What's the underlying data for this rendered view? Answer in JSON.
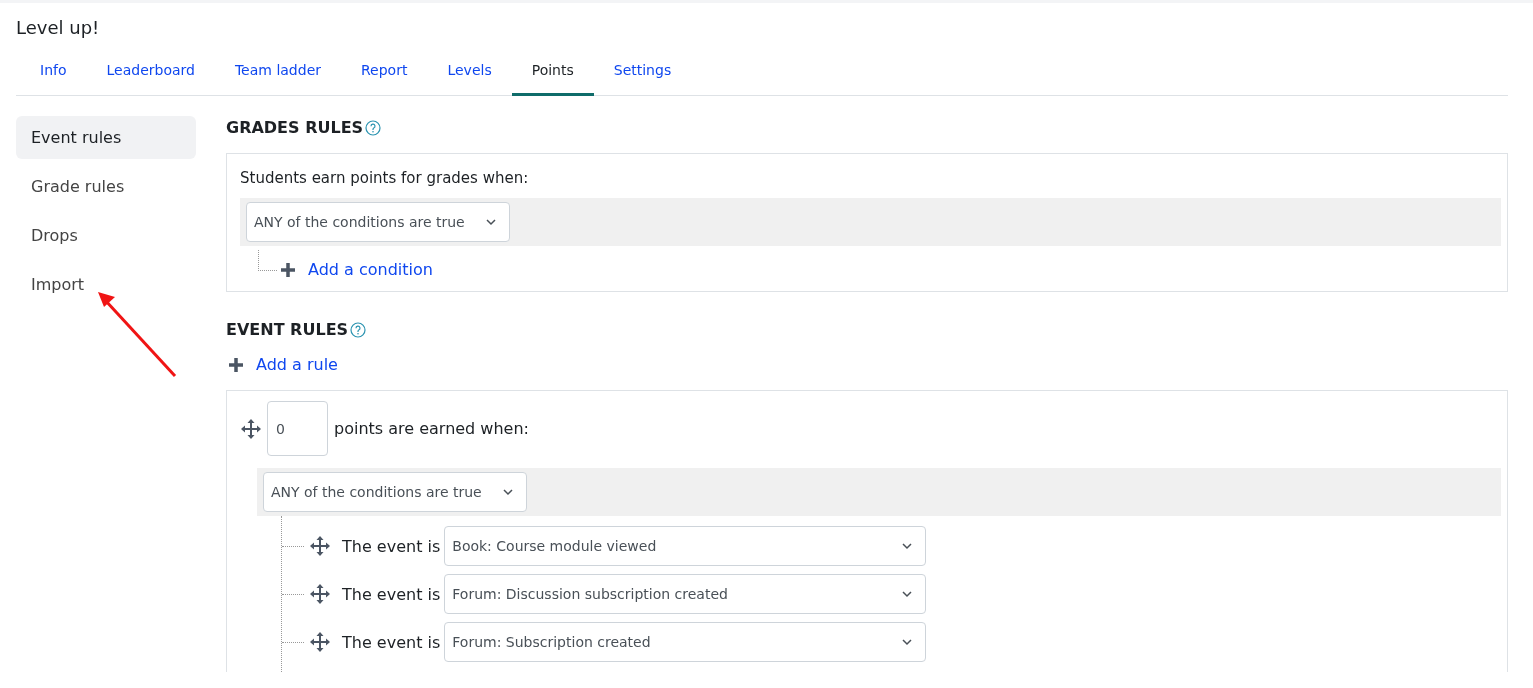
{
  "title": "Level up!",
  "tabs": [
    {
      "label": "Info",
      "selected": false
    },
    {
      "label": "Leaderboard",
      "selected": false
    },
    {
      "label": "Team ladder",
      "selected": false
    },
    {
      "label": "Report",
      "selected": false
    },
    {
      "label": "Levels",
      "selected": false
    },
    {
      "label": "Points",
      "selected": true
    },
    {
      "label": "Settings",
      "selected": false
    }
  ],
  "sidebar": {
    "items": [
      {
        "label": "Event rules",
        "selected": true
      },
      {
        "label": "Grade rules",
        "selected": false
      },
      {
        "label": "Drops",
        "selected": false
      },
      {
        "label": "Import",
        "selected": false
      }
    ]
  },
  "grade_rules": {
    "heading": "GRADES RULES",
    "intro": "Students earn points for grades when:",
    "condition_select": "ANY of the conditions are true",
    "add_condition": "Add a condition"
  },
  "event_rules": {
    "heading": "EVENT RULES",
    "add_rule": "Add a rule",
    "rules": [
      {
        "points": "0",
        "label": "points are earned when:",
        "condition_select": "ANY of the conditions are true",
        "conditions": [
          {
            "label": "The event is",
            "event": "Book: Course module viewed"
          },
          {
            "label": "The event is",
            "event": "Forum: Discussion subscription created"
          },
          {
            "label": "The event is",
            "event": "Forum: Subscription created"
          }
        ]
      }
    ]
  }
}
